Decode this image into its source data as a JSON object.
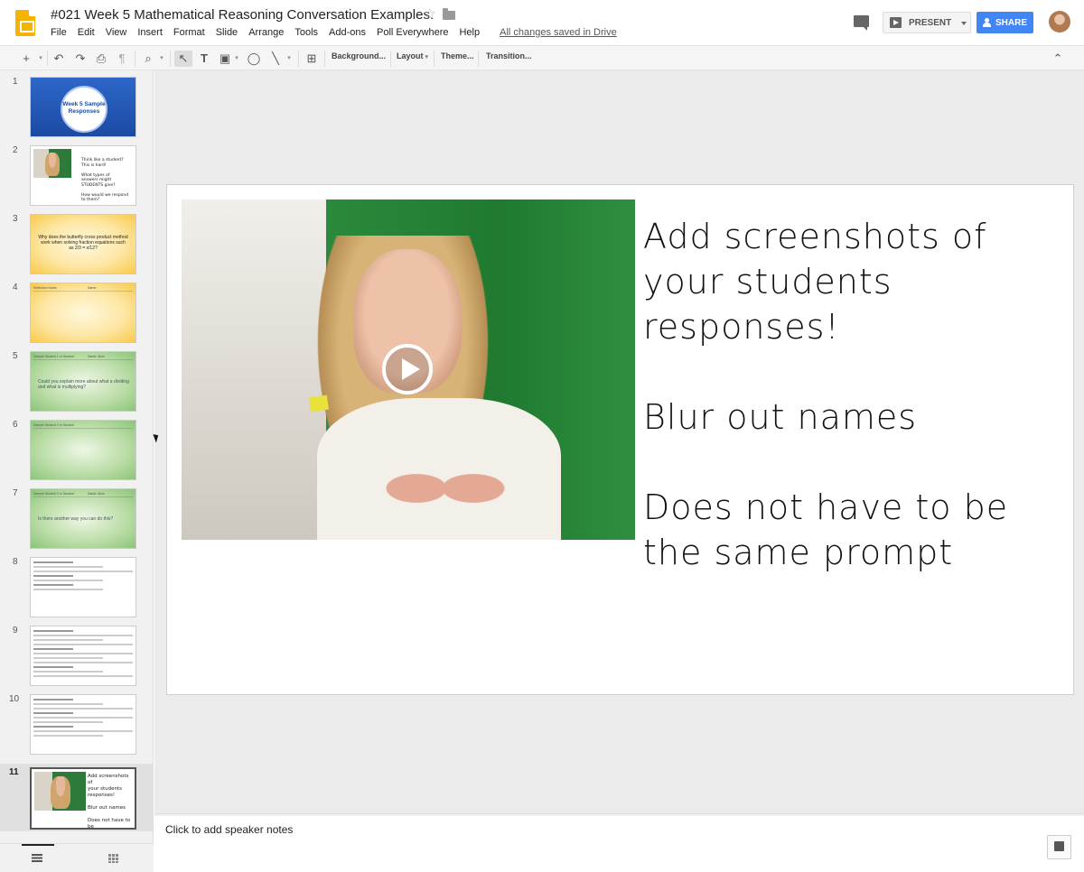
{
  "header": {
    "title": "#021 Week 5 Mathematical Reasoning Conversation Examples.",
    "menus": [
      "File",
      "Edit",
      "View",
      "Insert",
      "Format",
      "Slide",
      "Arrange",
      "Tools",
      "Add-ons",
      "Poll Everywhere",
      "Help"
    ],
    "saved_status": "All changes saved in Drive",
    "present_label": "PRESENT",
    "share_label": "SHARE"
  },
  "toolbar": {
    "plus_icon": "+",
    "undo_icon": "↶",
    "redo_icon": "↷",
    "print_icon": "⎙",
    "paint_icon": "¶",
    "zoom_icon": "⌕",
    "select_icon": "↖",
    "textbox_icon": "T",
    "image_icon": "▣",
    "shape_icon": "◯",
    "line_icon": "╲",
    "comment_icon": "⊞",
    "collapse_icon": "⌃",
    "background_label": "Background...",
    "layout_label": "Layout",
    "theme_label": "Theme...",
    "transition_label": "Transition..."
  },
  "filmstrip": {
    "slide_numbers": [
      "1",
      "2",
      "3",
      "4",
      "5",
      "6",
      "7",
      "8",
      "9",
      "10",
      "11"
    ],
    "slide1_text": "Week 5 Sample Responses",
    "slide2_text": "Think like a student?\nThis is hard!\n\nWhat types of\nanswers might\nSTUDENTS give?\n\nHow would we respond\nto them?",
    "slide3_text": "Why does the butterfly cross product method work when solving fraction equations such as 2/3 = x/12?",
    "slide4_header_left": "Reflection Notes",
    "slide4_header_right": "Name:",
    "slide5_header_left": "Sample Student 1 or Student",
    "slide5_header_right": "Name: Alice",
    "slide5_text": "Could you explain more about what a dividing and what is multiplying?",
    "slide6_header_left": "Sample Student 2 or Student",
    "slide7_header_left": "Sample Student 3 or Student",
    "slide7_header_right": "Name: Alice",
    "slide7_text": "Is there another way you can do this?",
    "slide11_text": "Add screenshots of\nyour students\nresponses!\n\nBlur out names\n\nDoes not have to be\nthe same prompt"
  },
  "slide": {
    "line1": "Add screenshots of",
    "line2": "your students",
    "line3": "responses!",
    "line4": "Blur out names",
    "line5": "Does not have to be",
    "line6": "the same prompt"
  },
  "notes": {
    "placeholder": "Click to add speaker notes"
  },
  "colors": {
    "accent": "#4285f4",
    "app_yellow": "#f4b400"
  }
}
